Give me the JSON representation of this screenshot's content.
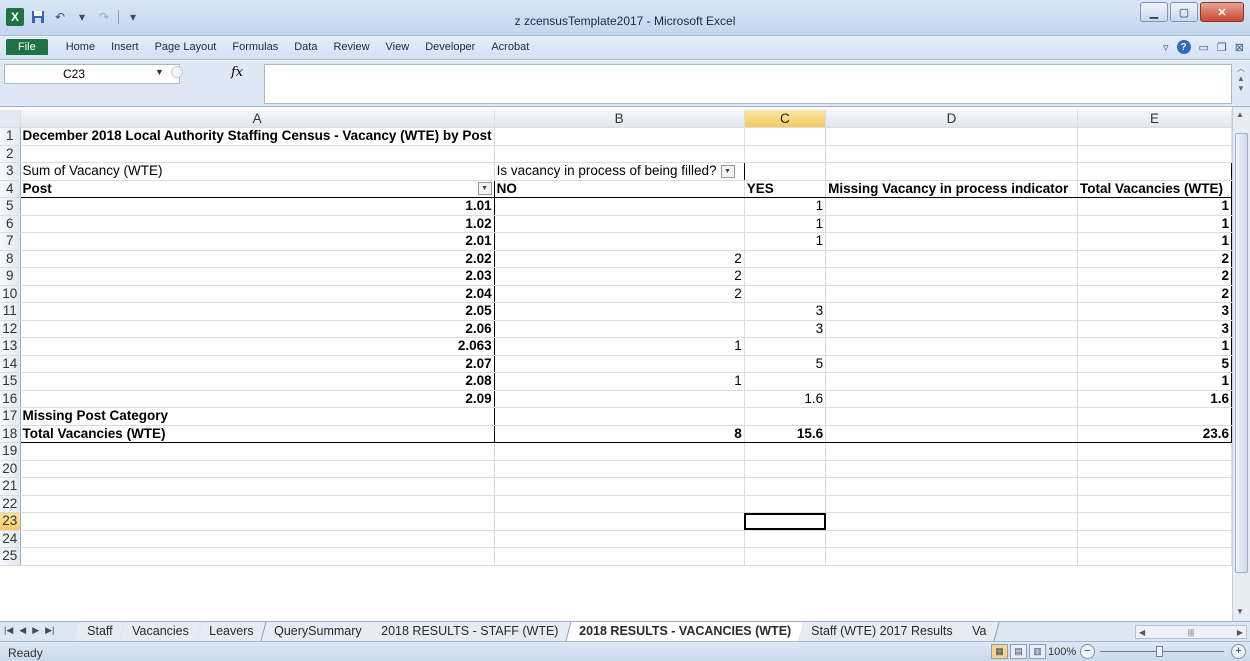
{
  "window": {
    "title": "z zcensusTemplate2017  -  Microsoft Excel",
    "app_icon": "X"
  },
  "ribbon": {
    "file_label": "File",
    "tabs": [
      "Home",
      "Insert",
      "Page Layout",
      "Formulas",
      "Data",
      "Review",
      "View",
      "Developer",
      "Acrobat"
    ]
  },
  "formula_bar": {
    "name_box": "C23",
    "fx_label": "fx",
    "formula": ""
  },
  "columns": [
    "A",
    "B",
    "C",
    "D",
    "E"
  ],
  "selected_cell": "C23",
  "rows": [
    {
      "n": "1",
      "cells": [
        "December 2018 Local Authority Staffing Census - Vacancy (WTE) by Post",
        "",
        "",
        "",
        ""
      ]
    },
    {
      "n": "2",
      "cells": [
        "",
        "",
        "",
        "",
        ""
      ]
    },
    {
      "n": "3",
      "cells": [
        "Sum of Vacancy (WTE)",
        "Is vacancy in process of being filled?",
        "",
        "",
        ""
      ]
    },
    {
      "n": "4",
      "cells": [
        "Post",
        "NO",
        "YES",
        "Missing Vacancy in process indicator",
        "Total Vacancies (WTE)"
      ]
    },
    {
      "n": "5",
      "cells": [
        "1.01",
        "",
        "1",
        "",
        "1"
      ]
    },
    {
      "n": "6",
      "cells": [
        "1.02",
        "",
        "1",
        "",
        "1"
      ]
    },
    {
      "n": "7",
      "cells": [
        "2.01",
        "",
        "1",
        "",
        "1"
      ]
    },
    {
      "n": "8",
      "cells": [
        "2.02",
        "2",
        "",
        "",
        "2"
      ]
    },
    {
      "n": "9",
      "cells": [
        "2.03",
        "2",
        "",
        "",
        "2"
      ]
    },
    {
      "n": "10",
      "cells": [
        "2.04",
        "2",
        "",
        "",
        "2"
      ]
    },
    {
      "n": "11",
      "cells": [
        "2.05",
        "",
        "3",
        "",
        "3"
      ]
    },
    {
      "n": "12",
      "cells": [
        "2.06",
        "",
        "3",
        "",
        "3"
      ]
    },
    {
      "n": "13",
      "cells": [
        "2.063",
        "1",
        "",
        "",
        "1"
      ]
    },
    {
      "n": "14",
      "cells": [
        "2.07",
        "",
        "5",
        "",
        "5"
      ]
    },
    {
      "n": "15",
      "cells": [
        "2.08",
        "1",
        "",
        "",
        "1"
      ]
    },
    {
      "n": "16",
      "cells": [
        "2.09",
        "",
        "1.6",
        "",
        "1.6"
      ]
    },
    {
      "n": "17",
      "cells": [
        "Missing Post Category",
        "",
        "",
        "",
        ""
      ]
    },
    {
      "n": "18",
      "cells": [
        "Total Vacancies (WTE)",
        "8",
        "15.6",
        "",
        "23.6"
      ]
    },
    {
      "n": "19",
      "cells": [
        "",
        "",
        "",
        "",
        ""
      ]
    },
    {
      "n": "20",
      "cells": [
        "",
        "",
        "",
        "",
        ""
      ]
    },
    {
      "n": "21",
      "cells": [
        "",
        "",
        "",
        "",
        ""
      ]
    },
    {
      "n": "22",
      "cells": [
        "",
        "",
        "",
        "",
        ""
      ]
    },
    {
      "n": "23",
      "cells": [
        "",
        "",
        "",
        "",
        ""
      ]
    },
    {
      "n": "24",
      "cells": [
        "",
        "",
        "",
        "",
        ""
      ]
    },
    {
      "n": "25",
      "cells": [
        "",
        "",
        "",
        "",
        ""
      ]
    }
  ],
  "sheet_tabs": [
    "Staff",
    "Vacancies",
    "Leavers",
    "QuerySummary",
    "2018 RESULTS - STAFF (WTE)",
    "2018 RESULTS - VACANCIES (WTE)",
    "Staff (WTE) 2017 Results",
    "Va"
  ],
  "active_sheet": "2018 RESULTS - VACANCIES (WTE)",
  "status": {
    "text": "Ready",
    "zoom": "100%",
    "zoom_minus": "−",
    "zoom_plus": "+"
  }
}
